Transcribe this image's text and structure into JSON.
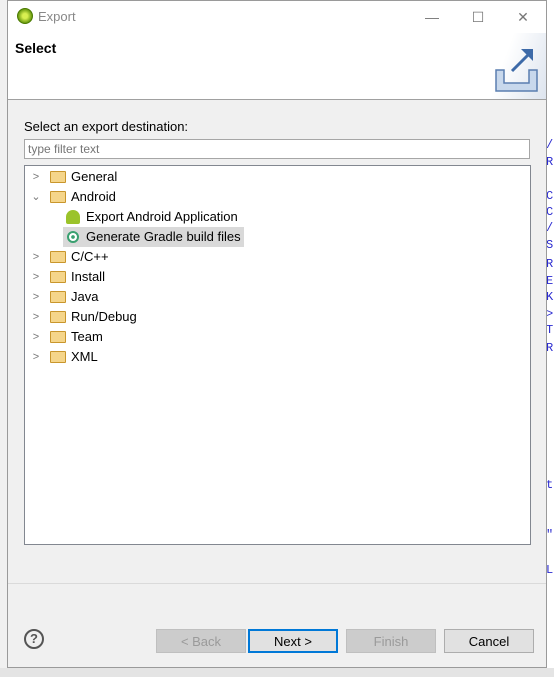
{
  "window": {
    "title": "Export",
    "minimize": "—",
    "maximize": "☐",
    "close": "✕"
  },
  "header": {
    "title": "Select"
  },
  "main": {
    "label": "Select an export destination:",
    "filter_placeholder": "type filter text",
    "tree": [
      {
        "label": "General",
        "expanded": false
      },
      {
        "label": "Android",
        "expanded": true,
        "children": [
          {
            "label": "Export Android Application",
            "icon": "android-icon"
          },
          {
            "label": "Generate Gradle build files",
            "icon": "gradle-icon",
            "selected": true
          }
        ]
      },
      {
        "label": "C/C++",
        "expanded": false
      },
      {
        "label": "Install",
        "expanded": false
      },
      {
        "label": "Java",
        "expanded": false
      },
      {
        "label": "Run/Debug",
        "expanded": false
      },
      {
        "label": "Team",
        "expanded": false
      },
      {
        "label": "XML",
        "expanded": false
      }
    ]
  },
  "footer": {
    "help": "?",
    "back": "< Back",
    "next": "Next >",
    "finish": "Finish",
    "cancel": "Cancel"
  },
  "background_code": [
    "/",
    "R",
    "C",
    "C",
    "/",
    "S",
    "R",
    "E",
    "K",
    ">",
    "T",
    "R",
    "t",
    "\"",
    "L"
  ],
  "colors": {
    "accent": "#0078d7",
    "selection": "#d9d9d9"
  }
}
